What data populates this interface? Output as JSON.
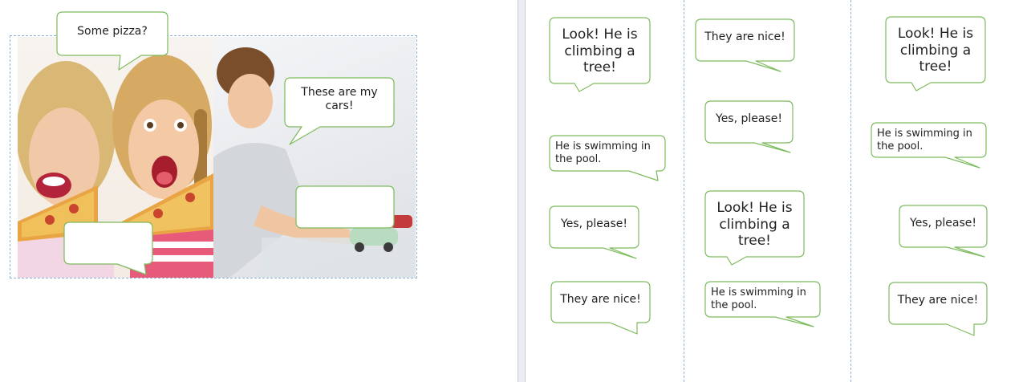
{
  "left_page": {
    "bubbles": {
      "pizza": "Some pizza?",
      "cars": "These are my cars!",
      "blank_girls": "",
      "blank_boy": ""
    }
  },
  "cards": {
    "col1": [
      "Look! He is climbing a tree!",
      "He is swimming in the pool.",
      "Yes, please!",
      "They are nice!"
    ],
    "col2": [
      "They are nice!",
      "Yes, please!",
      "Look! He is climbing a tree!",
      "He is swimming in the pool."
    ],
    "col3": [
      "Look! He is climbing a tree!",
      "He is swimming in the pool.",
      "Yes, please!",
      "They are nice!"
    ]
  },
  "colors": {
    "bubble_border": "#7dbb5e",
    "guide_line": "#8fb0d6",
    "gutter": "#e9ecf2"
  }
}
